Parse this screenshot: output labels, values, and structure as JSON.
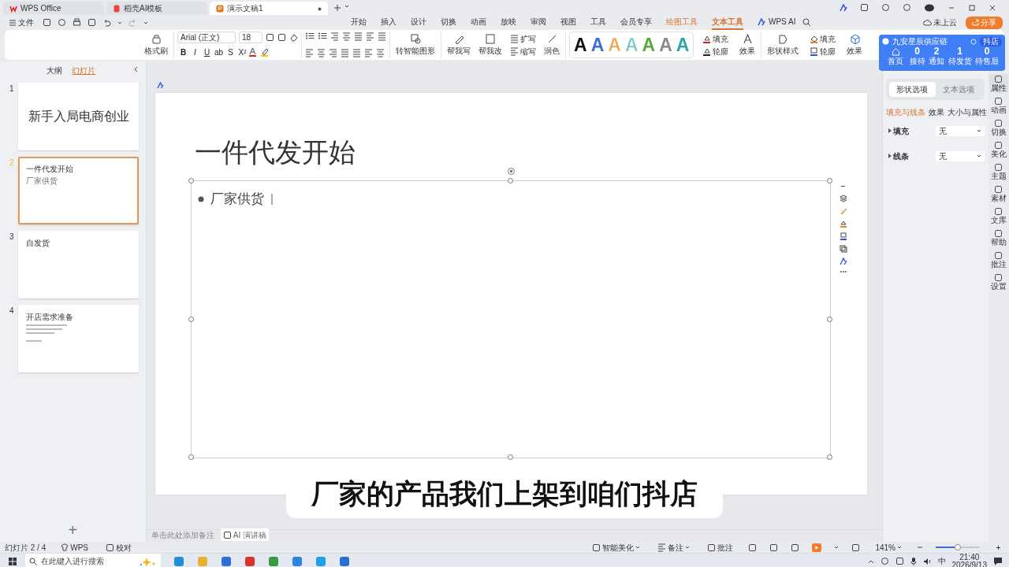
{
  "tabs": [
    {
      "label": "WPS Office",
      "selected": false
    },
    {
      "label": "稻壳AI模板",
      "selected": false
    },
    {
      "label": "演示文稿1",
      "selected": true
    }
  ],
  "file_menu": "文件",
  "menu": [
    {
      "label": "开始",
      "kind": "normal",
      "selected": false
    },
    {
      "label": "插入",
      "kind": "normal",
      "selected": false
    },
    {
      "label": "设计",
      "kind": "normal",
      "selected": false
    },
    {
      "label": "切换",
      "kind": "normal",
      "selected": false
    },
    {
      "label": "动画",
      "kind": "normal",
      "selected": false
    },
    {
      "label": "放映",
      "kind": "normal",
      "selected": false
    },
    {
      "label": "审阅",
      "kind": "normal",
      "selected": false
    },
    {
      "label": "视图",
      "kind": "normal",
      "selected": false
    },
    {
      "label": "工具",
      "kind": "normal",
      "selected": false
    },
    {
      "label": "会员专享",
      "kind": "normal",
      "selected": false
    },
    {
      "label": "绘图工具",
      "kind": "contextual",
      "selected": false
    },
    {
      "label": "文本工具",
      "kind": "contextual",
      "selected": true
    },
    {
      "label": "WPS AI",
      "kind": "ai",
      "selected": false
    }
  ],
  "cloud": "未上云",
  "share": "分享",
  "ribbon": {
    "format_painter": "格式刷",
    "font": "Arial (正文)",
    "size": "18",
    "format_buttons": [
      "B",
      "I",
      "U",
      "ab",
      "S",
      "X²"
    ],
    "smart_graphic": "转智能图形",
    "help_write": "帮我写",
    "help_edit": "帮我改",
    "expand": "扩写",
    "shrink": "缩写",
    "polish": "润色",
    "art_styles": [
      {
        "label": "A",
        "kind": "solid",
        "color": "#111111"
      },
      {
        "label": "A",
        "kind": "solid",
        "color": "#3b6fd1"
      },
      {
        "label": "A",
        "kind": "outline",
        "color": "#f0a040"
      },
      {
        "label": "A",
        "kind": "outline",
        "color": "#6cc4c4"
      },
      {
        "label": "A",
        "kind": "solid",
        "color": "#58a83a"
      },
      {
        "label": "A",
        "kind": "solid",
        "color": "#8a8a8a"
      },
      {
        "label": "A",
        "kind": "solid",
        "color": "#2aa6a6"
      }
    ],
    "text_fill": "填充",
    "text_outline": "轮廓",
    "text_effect": "效果",
    "shape_style": "形状样式",
    "shape_fill": "填充",
    "shape_outline": "轮廓",
    "shape_effect": "效果"
  },
  "widget": {
    "title": "九安星辰供应链",
    "badge": "抖店",
    "home": "首页",
    "stats": [
      {
        "value": "0",
        "label": "接待"
      },
      {
        "value": "2",
        "label": "通知"
      },
      {
        "value": "1",
        "label": "待发货"
      },
      {
        "value": "0",
        "label": "待售后"
      }
    ]
  },
  "left_panel": {
    "tabs": [
      {
        "label": "大纲",
        "selected": false
      },
      {
        "label": "幻灯片",
        "selected": true
      }
    ],
    "slides": [
      {
        "number": "1",
        "kind": "title",
        "title": "新手入局电商创业",
        "selected": false
      },
      {
        "number": "2",
        "kind": "content",
        "title": "一件代发开始",
        "bullets": [
          "厂家供货"
        ],
        "selected": true
      },
      {
        "number": "3",
        "kind": "content",
        "title": "自发货",
        "selected": false
      },
      {
        "number": "4",
        "kind": "content_lines",
        "title": "开店需求准备",
        "selected": false
      }
    ],
    "add": "+"
  },
  "slide": {
    "title": "一件代发开始",
    "bullet": "厂家供货"
  },
  "notes": {
    "placeholder": "单击此处添加备注",
    "ai": "AI 演讲稿"
  },
  "properties": {
    "tabs": [
      {
        "label": "形状选项",
        "selected": true
      },
      {
        "label": "文本选项",
        "selected": false
      }
    ],
    "subtabs": [
      {
        "label": "填充与线条",
        "selected": true
      },
      {
        "label": "效果",
        "selected": false
      },
      {
        "label": "大小与属性",
        "selected": false
      }
    ],
    "rows": [
      {
        "label": "填充",
        "value": "无",
        "expanded": false
      },
      {
        "label": "线条",
        "value": "无",
        "expanded": false
      }
    ]
  },
  "sidebar": [
    {
      "label": "属性",
      "selected": true
    },
    {
      "label": "动画",
      "selected": false
    },
    {
      "label": "切换",
      "selected": false
    },
    {
      "label": "美化",
      "selected": false
    },
    {
      "label": "主题",
      "selected": false
    },
    {
      "label": "素材",
      "selected": false
    },
    {
      "label": "文库",
      "selected": false
    },
    {
      "label": "帮助",
      "selected": false
    },
    {
      "label": "批注",
      "selected": false
    },
    {
      "label": "设置",
      "selected": false
    }
  ],
  "status_bar": {
    "slide": "幻灯片 2 / 4",
    "theme": "WPS",
    "proof": "校对",
    "beautify": "智能美化",
    "notes": "备注",
    "comments": "批注",
    "zoom": "141%",
    "zoom_slider": {
      "level": 0.5
    },
    "plus": "+"
  },
  "caption": "厂家的产品我们上架到咱们抖店",
  "taskbar": {
    "search_placeholder": "在此键入进行搜索",
    "ime": "中",
    "time": "21:40",
    "date": "2026/9/13"
  }
}
